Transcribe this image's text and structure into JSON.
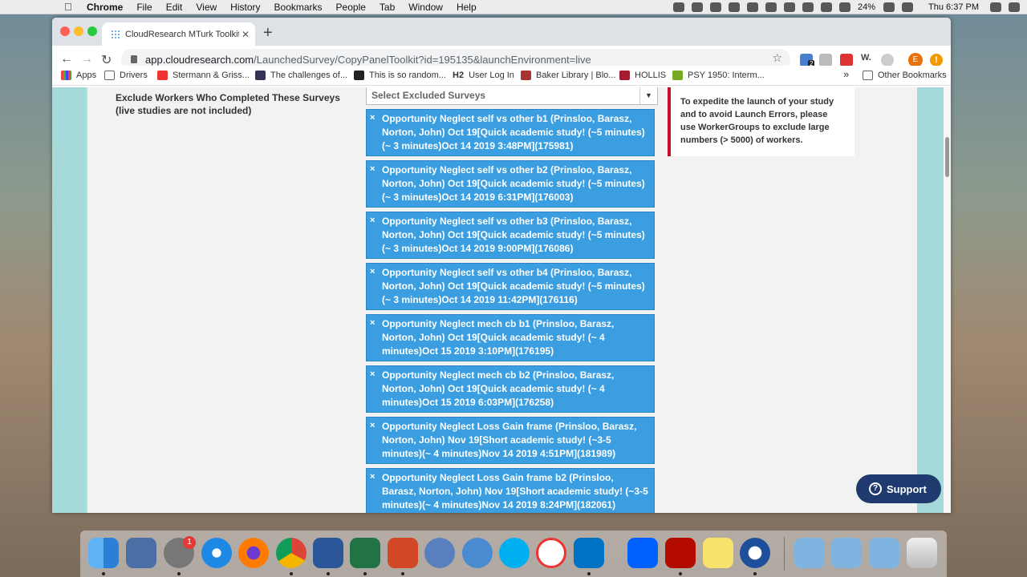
{
  "menubar": {
    "items": [
      "Chrome",
      "File",
      "Edit",
      "View",
      "History",
      "Bookmarks",
      "People",
      "Tab",
      "Window",
      "Help"
    ],
    "battery": "24%",
    "clock": "Thu 6:37 PM"
  },
  "tab": {
    "title": "CloudResearch MTurk Toolkit"
  },
  "omnibox": {
    "host": "app.cloudresearch.com",
    "path": "/LaunchedSurvey/CopyPanelToolkit?id=195135&launchEnvironment=live"
  },
  "extension_badge": "2",
  "extension_w": "W.",
  "profile_initial": "E",
  "bookmarks": [
    "Apps",
    "Drivers",
    "Stermann & Griss...",
    "The challenges of...",
    "This is so random...",
    "User Log In",
    "Baker Library | Blo...",
    "HOLLIS",
    "PSY 1950: Interm..."
  ],
  "bookmark_h2": "H2",
  "bookmarks_overflow": "»",
  "other_bookmarks": "Other Bookmarks",
  "form": {
    "exclude_label": "Exclude Workers Who Completed These Surveys (live studies are not included)",
    "select_placeholder": "Select Excluded Surveys",
    "chip_remove": "×",
    "excluded_surveys": [
      "Opportunity Neglect self vs other b1 (Prinsloo, Barasz, Norton, John) Oct 19[Quick academic study! (~5 minutes) (~ 3 minutes)Oct 14 2019 3:48PM](175981)",
      "Opportunity Neglect self vs other b2 (Prinsloo, Barasz, Norton, John) Oct 19[Quick academic study! (~5 minutes) (~ 3 minutes)Oct 14 2019 6:31PM](176003)",
      "Opportunity Neglect self vs other b3 (Prinsloo, Barasz, Norton, John) Oct 19[Quick academic study! (~5 minutes) (~ 3 minutes)Oct 14 2019 9:00PM](176086)",
      "Opportunity Neglect self vs other b4 (Prinsloo, Barasz, Norton, John) Oct 19[Quick academic study! (~5 minutes) (~ 3 minutes)Oct 14 2019 11:42PM](176116)",
      "Opportunity Neglect mech cb b1 (Prinsloo, Barasz, Norton, John) Oct 19[Quick academic study! (~ 4 minutes)Oct 15 2019 3:10PM](176195)",
      "Opportunity Neglect mech cb b2 (Prinsloo, Barasz, Norton, John) Oct 19[Quick academic study! (~ 4 minutes)Oct 15 2019 6:03PM](176258)",
      "Opportunity Neglect Loss Gain frame (Prinsloo, Barasz, Norton, John) Nov 19[Short academic study! (~3-5 minutes)(~ 4 minutes)Nov 14 2019 4:51PM](181989)",
      "Opportunity Neglect Loss Gain frame b2 (Prinsloo, Barasz, Norton, John) Nov 19[Short academic study! (~3-5 minutes)(~ 4 minutes)Nov 14 2019 8:24PM](182061)"
    ]
  },
  "notice": "To expedite the launch of your study and to avoid Launch Errors, please use WorkerGroups to exclude large numbers (> 5000) of workers.",
  "support": {
    "label": "Support",
    "icon_glyph": "?"
  },
  "dock": {
    "sys_prefs_badge": "1"
  },
  "colors": {
    "chip_blue": "#3a9ee0",
    "notice_red": "#c8102e",
    "support_navy": "#1f3a6e",
    "teal_bg": "#a6d9d9"
  }
}
